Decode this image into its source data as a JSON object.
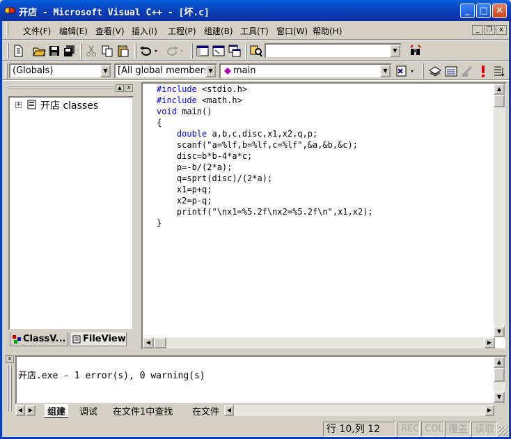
{
  "window": {
    "title": "开店 - Microsoft Visual C++ - [坏.c]",
    "minimize": "_",
    "maximize": "□",
    "close": "✕"
  },
  "menu": [
    {
      "label": "文件(F)"
    },
    {
      "label": "编辑(E)"
    },
    {
      "label": "查看(V)"
    },
    {
      "label": "插入(I)"
    },
    {
      "label": "工程(P)"
    },
    {
      "label": "组建(B)"
    },
    {
      "label": "工具(T)"
    },
    {
      "label": "窗口(W)"
    },
    {
      "label": "帮助(H)"
    }
  ],
  "mdi_controls": {
    "minimize": "_",
    "restore": "❐",
    "close": "x"
  },
  "toolbar": {
    "find_combo_value": ""
  },
  "wizardbar": {
    "class_combo": "(Globals)",
    "filter_combo": "[All global members",
    "member_combo": "main"
  },
  "workspace": {
    "tree_root": "开店 classes",
    "tabs": [
      {
        "label": "ClassV..."
      },
      {
        "label": "FileView"
      }
    ]
  },
  "editor": {
    "lines": [
      [
        {
          "t": "#include",
          "k": 1
        },
        {
          "t": " <stdio.h>",
          "k": 0
        }
      ],
      [
        {
          "t": "#include",
          "k": 1
        },
        {
          "t": " <math.h>",
          "k": 0
        }
      ],
      [
        {
          "t": "void",
          "k": 1
        },
        {
          "t": " main()",
          "k": 0
        }
      ],
      [
        {
          "t": "{",
          "k": 0
        }
      ],
      [
        {
          "t": "    ",
          "k": 0
        },
        {
          "t": "double",
          "k": 1
        },
        {
          "t": " a,b,c,disc,x1,x2,q,p;",
          "k": 0
        }
      ],
      [
        {
          "t": "    scanf(\"a=%lf,b=%lf,c=%lf\",&a,&b,&c);",
          "k": 0
        }
      ],
      [
        {
          "t": "    disc=b*b-4*a*c;",
          "k": 0
        }
      ],
      [
        {
          "t": "    p=-b/(2*a);",
          "k": 0
        }
      ],
      [
        {
          "t": "    q=sprt(disc)/(2*a);",
          "k": 0
        }
      ],
      [
        {
          "t": "    x1=p+q;",
          "k": 0
        }
      ],
      [
        {
          "t": "    x2=p-q;",
          "k": 0
        }
      ],
      [
        {
          "t": "    printf(\"\\nx1=%5.2f\\nx2=%5.2f\\n\",x1,x2);",
          "k": 0
        }
      ],
      [
        {
          "t": "}",
          "k": 0
        }
      ]
    ]
  },
  "output": {
    "message": "开店.exe - 1 error(s), 0 warning(s)",
    "tabs": [
      {
        "label": "组建"
      },
      {
        "label": "调试"
      },
      {
        "label": "在文件1中查找"
      },
      {
        "label": "在文件"
      }
    ]
  },
  "status": {
    "position": "行 10,列 12",
    "rec": "REC",
    "col": "COL",
    "ovr": "覆盖",
    "read": "读取"
  },
  "colors": {
    "keyword": "#0000ff",
    "titlebar": "#0a4fd0"
  }
}
